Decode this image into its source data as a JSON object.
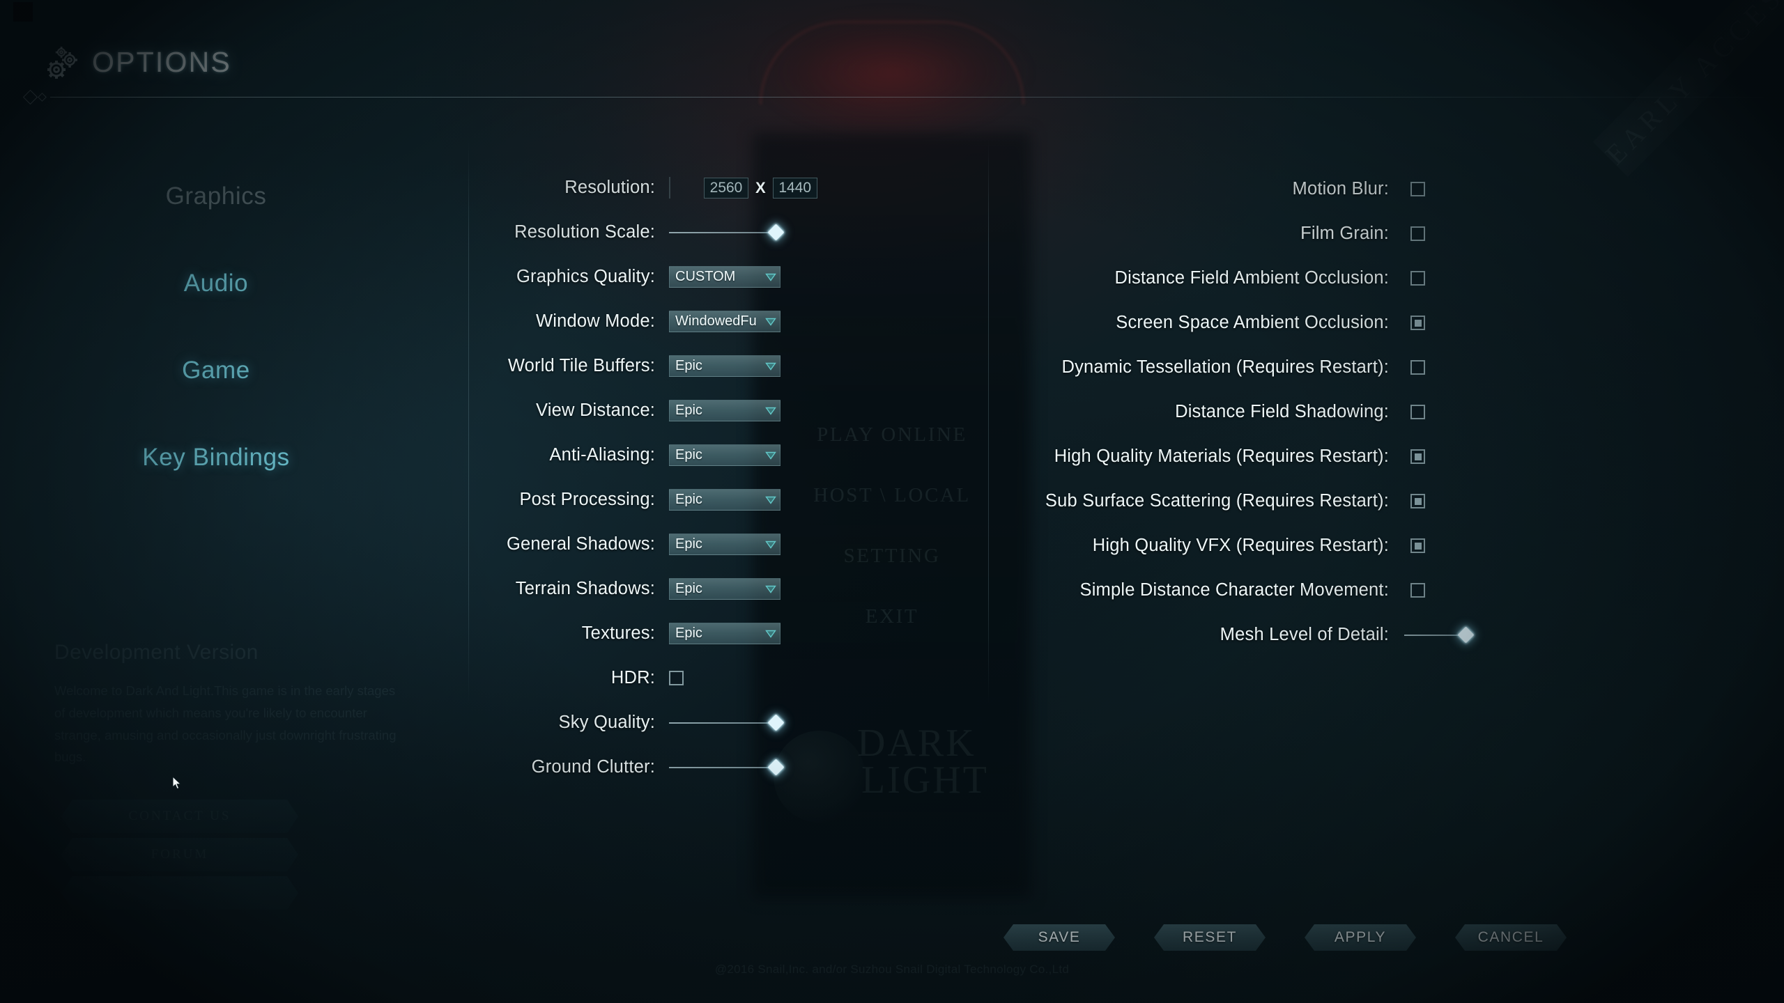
{
  "header": {
    "title": "OPTIONS",
    "gear_icon": "gears-icon"
  },
  "watermarks": {
    "early_access": "EARLY ACCESS",
    "logo_line1": "DARK",
    "logo_line2": "LIGHT",
    "copyright": "@2016 Snail,Inc. and/or Suzhou Snail Digital Technology Co.,Ltd"
  },
  "background_menu": {
    "items": [
      "PLAY ONLINE",
      "HOST \\ LOCAL",
      "SETTING",
      "EXIT"
    ],
    "buttons": [
      "CONTACT US",
      "FORUM",
      ""
    ]
  },
  "dev_notice": {
    "title": "Development Version",
    "body": "Welcome to Dark And Light.This game is in the early stages of development which means you're likely to encounter strange, amusing and occasionally just downright frustrating bugs."
  },
  "sidebar": {
    "items": [
      {
        "label": "Graphics",
        "state": "selected"
      },
      {
        "label": "Audio",
        "state": "normal"
      },
      {
        "label": "Game",
        "state": "normal"
      },
      {
        "label": "Key Bindings",
        "state": "normal"
      }
    ]
  },
  "settings_left": [
    {
      "label": "Resolution:",
      "type": "dropdown_resolution",
      "value": "2560x1440",
      "width": "2560",
      "height": "1440",
      "separator": "X"
    },
    {
      "label": "Resolution Scale:",
      "type": "slider",
      "fill": 100
    },
    {
      "label": "Graphics Quality:",
      "type": "dropdown",
      "value": "CUSTOM"
    },
    {
      "label": "Window Mode:",
      "type": "dropdown",
      "value": "WindowedFu"
    },
    {
      "label": "World Tile Buffers:",
      "type": "dropdown",
      "value": "Epic"
    },
    {
      "label": "View Distance:",
      "type": "dropdown",
      "value": "Epic"
    },
    {
      "label": "Anti-Aliasing:",
      "type": "dropdown",
      "value": "Epic"
    },
    {
      "label": "Post Processing:",
      "type": "dropdown",
      "value": "Epic"
    },
    {
      "label": "General Shadows:",
      "type": "dropdown",
      "value": "Epic"
    },
    {
      "label": "Terrain Shadows:",
      "type": "dropdown",
      "value": "Epic"
    },
    {
      "label": "Textures:",
      "type": "dropdown",
      "value": "Epic"
    },
    {
      "label": "HDR:",
      "type": "checkbox",
      "checked": false
    },
    {
      "label": "Sky Quality:",
      "type": "slider",
      "fill": 100
    },
    {
      "label": "Ground Clutter:",
      "type": "slider",
      "fill": 100
    }
  ],
  "settings_right": [
    {
      "label": "Motion Blur:",
      "type": "checkbox",
      "checked": false
    },
    {
      "label": "Film Grain:",
      "type": "checkbox",
      "checked": false
    },
    {
      "label": "Distance Field Ambient Occlusion:",
      "type": "checkbox",
      "checked": false
    },
    {
      "label": "Screen Space Ambient Occlusion:",
      "type": "checkbox",
      "checked": true
    },
    {
      "label": "Dynamic Tessellation (Requires Restart):",
      "type": "checkbox",
      "checked": false
    },
    {
      "label": "Distance Field Shadowing:",
      "type": "checkbox",
      "checked": false
    },
    {
      "label": "High Quality Materials (Requires Restart):",
      "type": "checkbox",
      "checked": true
    },
    {
      "label": "Sub Surface Scattering (Requires Restart):",
      "type": "checkbox",
      "checked": true
    },
    {
      "label": "High Quality VFX (Requires Restart):",
      "type": "checkbox",
      "checked": true
    },
    {
      "label": "Simple Distance Character Movement:",
      "type": "checkbox",
      "checked": false
    },
    {
      "label": "Mesh Level of Detail:",
      "type": "slider",
      "fill": 100
    }
  ],
  "actions": [
    {
      "label": "SAVE"
    },
    {
      "label": "RESET"
    },
    {
      "label": "APPLY"
    },
    {
      "label": "CANCEL"
    }
  ],
  "colors": {
    "accent_cyan": "#7fe4f4",
    "text_primary": "#eef7f8",
    "dropdown_bg": "#6c919899",
    "slider_thumb": "#dff4fb"
  }
}
